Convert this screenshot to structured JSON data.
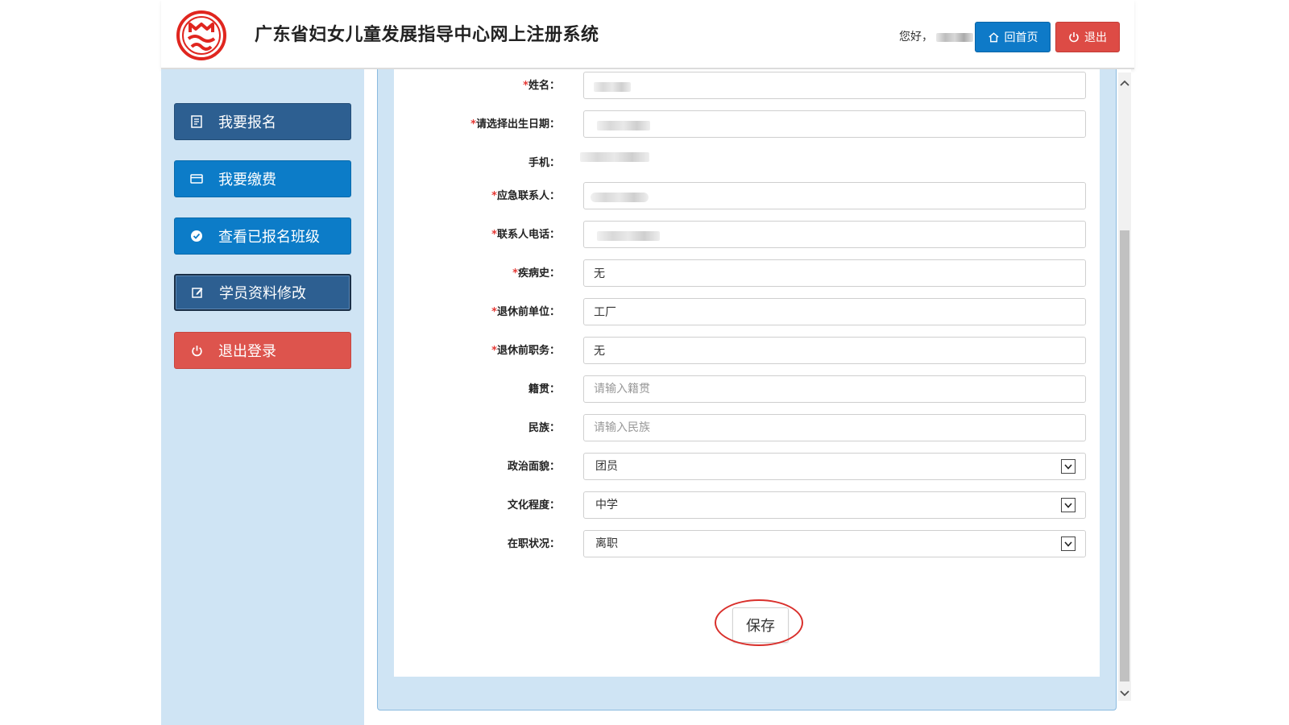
{
  "header": {
    "title": "广东省妇女儿童发展指导中心网上注册系统",
    "greeting": "您好，",
    "home_label": "回首页",
    "logout_label": "退出"
  },
  "sidebar": {
    "items": [
      {
        "label": "我要报名",
        "icon": "register-icon"
      },
      {
        "label": "我要缴费",
        "icon": "card-icon"
      },
      {
        "label": "查看已报名班级",
        "icon": "check-circle-icon"
      },
      {
        "label": "学员资料修改",
        "icon": "edit-icon"
      },
      {
        "label": "退出登录",
        "icon": "power-icon"
      }
    ]
  },
  "form": {
    "fields": [
      {
        "label": "姓名：",
        "required": true
      },
      {
        "label": "请选择出生日期：",
        "required": true
      },
      {
        "label": "手机：",
        "required": false
      },
      {
        "label": "应急联系人：",
        "required": true
      },
      {
        "label": "联系人电话：",
        "required": true
      },
      {
        "label": "疾病史：",
        "required": true,
        "value": "无"
      },
      {
        "label": "退休前单位：",
        "required": true,
        "value": "工厂"
      },
      {
        "label": "退休前职务：",
        "required": true,
        "value": "无"
      },
      {
        "label": "籍贯：",
        "required": false,
        "placeholder": "请输入籍贯"
      },
      {
        "label": "民族：",
        "required": false,
        "placeholder": "请输入民族"
      },
      {
        "label": "政治面貌：",
        "required": false,
        "value": "团员"
      },
      {
        "label": "文化程度：",
        "required": false,
        "value": "中学"
      },
      {
        "label": "在职状况：",
        "required": false,
        "value": "离职"
      }
    ],
    "required_mark": "*",
    "save_label": "保存"
  },
  "colors": {
    "primary_blue": "#0c7cc8",
    "dark_blue": "#2d5f91",
    "danger_red": "#dd544d",
    "sidebar_bg": "#cfe4f4"
  }
}
